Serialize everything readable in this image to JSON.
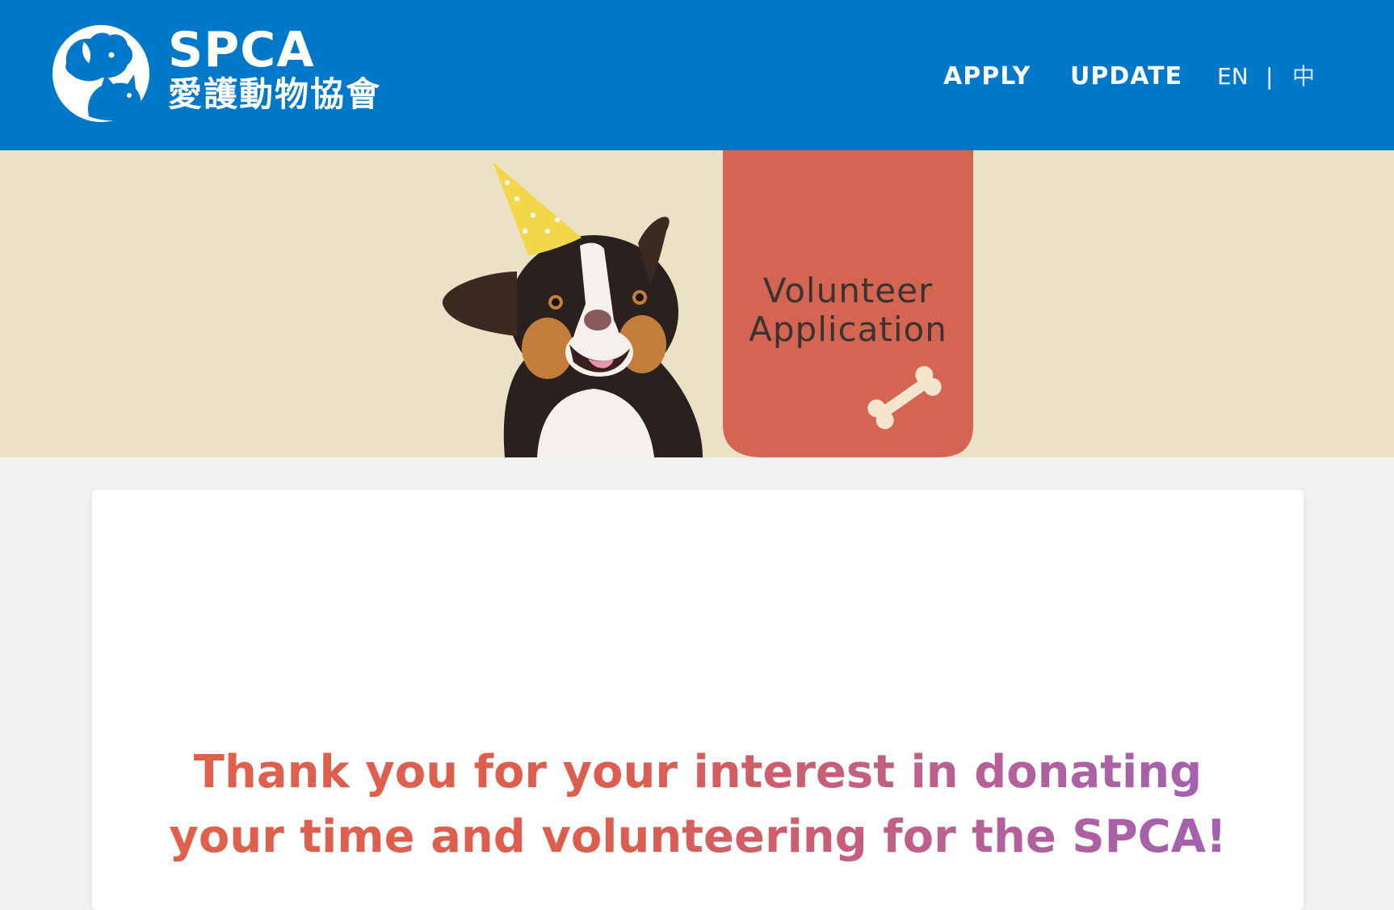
{
  "header": {
    "logo": {
      "name_en": "SPCA",
      "name_zh": "愛護動物協會",
      "icon": "dog-and-cat-icon"
    },
    "nav": {
      "apply_label": "APPLY",
      "update_label": "UPDATE"
    },
    "language": {
      "en_label": "EN",
      "separator": "|",
      "zh_label": "中"
    },
    "background_color": "#0078c9"
  },
  "banner": {
    "title_line1": "Volunteer",
    "title_line2": "Application",
    "background_color": "#ebe1c4",
    "accent_color": "#d46553",
    "decoration_icon": "bone-icon",
    "image": "dog-with-party-hat"
  },
  "content": {
    "thank_you_line1": "Thank you for your interest in donating",
    "thank_you_line2": "your time and volunteering for the SPCA!",
    "gradient_start": "#e0604a",
    "gradient_end": "#9a62b8"
  }
}
